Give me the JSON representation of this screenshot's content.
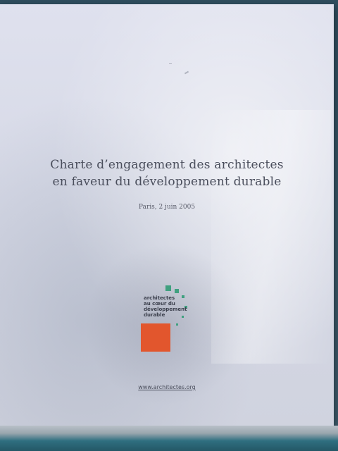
{
  "document": {
    "title_line1": "Charte d’engagement des architectes",
    "title_line2": "en faveur du développement durable",
    "date": "Paris, 2 juin 2005",
    "url": "www.architectes.org"
  },
  "logo": {
    "line1": "architectes",
    "line2": "au cœur du",
    "line3": "développement",
    "line4": "durable",
    "accent_color": "#3fa07f",
    "box_color": "#e2562d"
  },
  "colors": {
    "cover": "#d8dbe8",
    "text": "#4a4e5c"
  }
}
